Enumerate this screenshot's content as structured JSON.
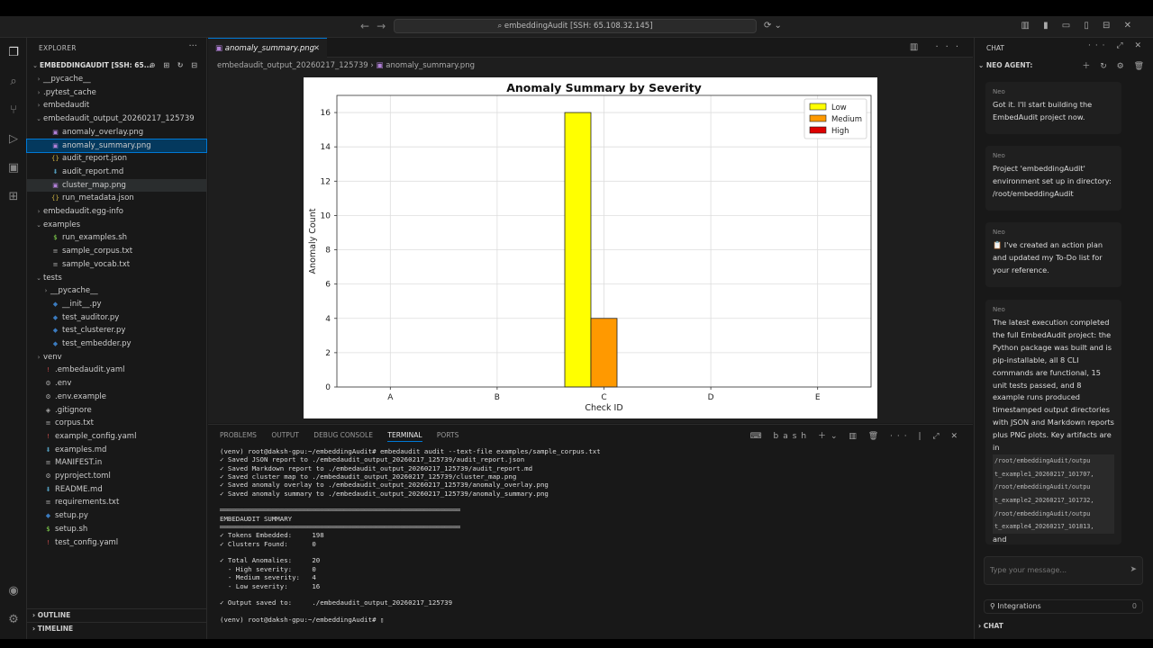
{
  "titlebar": {
    "search": "embeddingAudit [SSH: 65.108.32.145]",
    "back_icon": "←",
    "forward_icon": "→"
  },
  "activity": {
    "icons": [
      "files-icon",
      "search-icon",
      "source-control-icon",
      "run-debug-icon",
      "remote-explorer-icon",
      "extensions-icon"
    ]
  },
  "explorer": {
    "title": "EXPLORER",
    "workspace": "EMBEDDINGAUDIT [SSH: 65...",
    "items": [
      {
        "label": "__pycache__",
        "type": "folder",
        "depth": 0,
        "open": false
      },
      {
        "label": ".pytest_cache",
        "type": "folder",
        "depth": 0,
        "open": false
      },
      {
        "label": "embedaudit",
        "type": "folder",
        "depth": 0,
        "open": false
      },
      {
        "label": "embedaudit_output_20260217_125739",
        "type": "folder",
        "depth": 0,
        "open": true
      },
      {
        "label": "anomaly_overlay.png",
        "type": "png",
        "depth": 1
      },
      {
        "label": "anomaly_summary.png",
        "type": "png",
        "depth": 1,
        "selected": true
      },
      {
        "label": "audit_report.json",
        "type": "json",
        "depth": 1
      },
      {
        "label": "audit_report.md",
        "type": "md",
        "depth": 1
      },
      {
        "label": "cluster_map.png",
        "type": "png",
        "depth": 1,
        "hover": true
      },
      {
        "label": "run_metadata.json",
        "type": "json",
        "depth": 1
      },
      {
        "label": "embedaudit.egg-info",
        "type": "folder",
        "depth": 0,
        "open": false
      },
      {
        "label": "examples",
        "type": "folder",
        "depth": 0,
        "open": true
      },
      {
        "label": "run_examples.sh",
        "type": "sh",
        "depth": 1
      },
      {
        "label": "sample_corpus.txt",
        "type": "txt",
        "depth": 1
      },
      {
        "label": "sample_vocab.txt",
        "type": "txt",
        "depth": 1
      },
      {
        "label": "tests",
        "type": "folder",
        "depth": 0,
        "open": true
      },
      {
        "label": "__pycache__",
        "type": "folder",
        "depth": 1,
        "open": false
      },
      {
        "label": "__init__.py",
        "type": "py",
        "depth": 1
      },
      {
        "label": "test_auditor.py",
        "type": "py",
        "depth": 1
      },
      {
        "label": "test_clusterer.py",
        "type": "py",
        "depth": 1
      },
      {
        "label": "test_embedder.py",
        "type": "py",
        "depth": 1
      },
      {
        "label": "venv",
        "type": "folder",
        "depth": 0,
        "open": false
      },
      {
        "label": ".embedaudit.yaml",
        "type": "yaml",
        "depth": 0
      },
      {
        "label": ".env",
        "type": "env",
        "depth": 0
      },
      {
        "label": ".env.example",
        "type": "env",
        "depth": 0
      },
      {
        "label": ".gitignore",
        "type": "git",
        "depth": 0
      },
      {
        "label": "corpus.txt",
        "type": "txt",
        "depth": 0
      },
      {
        "label": "example_config.yaml",
        "type": "yaml",
        "depth": 0
      },
      {
        "label": "examples.md",
        "type": "md",
        "depth": 0
      },
      {
        "label": "MANIFEST.in",
        "type": "txt",
        "depth": 0
      },
      {
        "label": "pyproject.toml",
        "type": "toml",
        "depth": 0
      },
      {
        "label": "README.md",
        "type": "md",
        "depth": 0
      },
      {
        "label": "requirements.txt",
        "type": "txt",
        "depth": 0
      },
      {
        "label": "setup.py",
        "type": "py",
        "depth": 0
      },
      {
        "label": "setup.sh",
        "type": "sh",
        "depth": 0
      },
      {
        "label": "test_config.yaml",
        "type": "yaml",
        "depth": 0
      }
    ],
    "outline": "OUTLINE",
    "timeline": "TIMELINE"
  },
  "editor": {
    "tab": "anomaly_summary.png",
    "breadcrumb": [
      "embedaudit_output_20260217_125739",
      "anomaly_summary.png"
    ]
  },
  "chart_data": {
    "type": "bar",
    "title": "Anomaly Summary by Severity",
    "xlabel": "Check ID",
    "ylabel": "Anomaly Count",
    "categories": [
      "A",
      "B",
      "C",
      "D",
      "E"
    ],
    "series": [
      {
        "name": "Low",
        "color": "#ffff00",
        "values": [
          0,
          0,
          16,
          0,
          0
        ]
      },
      {
        "name": "Medium",
        "color": "#ff9900",
        "values": [
          0,
          0,
          4,
          0,
          0
        ]
      },
      {
        "name": "High",
        "color": "#dd0000",
        "values": [
          0,
          0,
          0,
          0,
          0
        ]
      }
    ],
    "ylim": [
      0,
      17
    ],
    "yticks": [
      0,
      2,
      4,
      6,
      8,
      10,
      12,
      14,
      16
    ],
    "grid": true,
    "legend": "top-right"
  },
  "panel": {
    "tabs": [
      "PROBLEMS",
      "OUTPUT",
      "DEBUG CONSOLE",
      "TERMINAL",
      "PORTS"
    ],
    "active": "TERMINAL",
    "shell": "bash",
    "lines": [
      "(venv) root@daksh-gpu:~/embeddingAudit# embedaudit audit --text-file examples/sample_corpus.txt",
      "✓ Saved JSON report to ./embedaudit_output_20260217_125739/audit_report.json",
      "✓ Saved Markdown report to ./embedaudit_output_20260217_125739/audit_report.md",
      "✓ Saved cluster map to ./embedaudit_output_20260217_125739/cluster_map.png",
      "✓ Saved anomaly overlay to ./embedaudit_output_20260217_125739/anomaly_overlay.png",
      "✓ Saved anomaly summary to ./embedaudit_output_20260217_125739/anomaly_summary.png",
      "",
      "════════════════════════════════════════════════════════════",
      "EMBEDAUDIT SUMMARY",
      "════════════════════════════════════════════════════════════",
      "✓ Tokens Embedded:     198",
      "✓ Clusters Found:      0",
      "",
      "✓ Total Anomalies:     20",
      "  - High severity:     0",
      "  - Medium severity:   4",
      "  - Low severity:      16",
      "",
      "✓ Output saved to:     ./embedaudit_output_20260217_125739",
      "",
      "(venv) root@daksh-gpu:~/embeddingAudit# ▯"
    ]
  },
  "chat": {
    "title": "CHAT",
    "agent": "NEO AGENT:",
    "messages": [
      {
        "from": "Neo",
        "text": "Got it. I'll start building the EmbedAudit project now."
      },
      {
        "from": "Neo",
        "text": "Project 'embeddingAudit' environment set up in directory: /root/embeddingAudit"
      },
      {
        "from": "Neo",
        "text": "📋 I've created an action plan and updated my To-Do list for your reference."
      },
      {
        "from": "Neo",
        "text": "The latest execution completed the full EmbedAudit project: the Python package was built and is pip-installable, all 8 CLI commands are functional, 15 unit tests passed, and 8 example runs produced timestamped output directories with JSON and Markdown reports plus PNG plots. Key artifacts are in",
        "code": [
          "/root/embeddingAudit/outpu",
          "t_example1_20260217_101707,",
          "/root/embeddingAudit/outpu",
          "t_example2_20260217_101732,",
          "/root/embeddingAudit/outpu",
          "t_example4_20260217_101813,"
        ],
        "tail": "and"
      }
    ],
    "placeholder": "Type your message...",
    "integrations": "Integrations",
    "integrations_count": "0",
    "footer": "CHAT"
  }
}
